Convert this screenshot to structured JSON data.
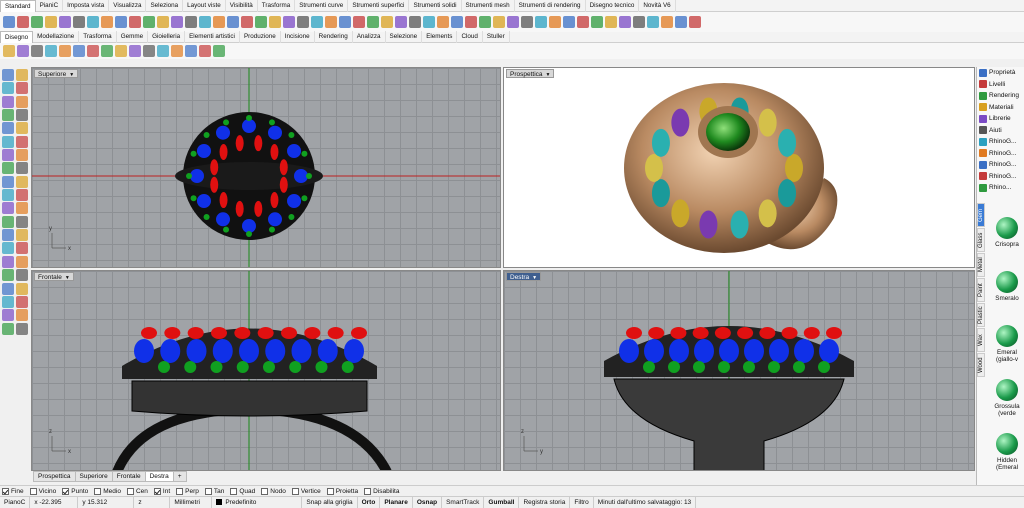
{
  "menu_tabs": [
    "Standard",
    "PianiC",
    "Imposta vista",
    "Visualizza",
    "Seleziona",
    "Layout viste",
    "Visibilità",
    "Trasforma",
    "Strumenti curve",
    "Strumenti superfici",
    "Strumenti solidi",
    "Strumenti mesh",
    "Strumenti di rendering",
    "Disegno tecnico",
    "Novità V6"
  ],
  "ribbon_tabs": [
    "Disegno",
    "Modellazione",
    "Trasforma",
    "Gemme",
    "Gioielleria",
    "Elementi artistici",
    "Produzione",
    "Incisione",
    "Rendering",
    "Analizza",
    "Selezione",
    "Elements",
    "Cloud",
    "Stuller"
  ],
  "viewports": {
    "top": "Superiore",
    "perspective": "Prospettica",
    "front": "Frontale",
    "right": "Destra"
  },
  "viewport_tabs": [
    "Prospettica",
    "Superiore",
    "Frontale",
    "Destra"
  ],
  "snaps": [
    {
      "label": "Fine",
      "on": true
    },
    {
      "label": "Vicino",
      "on": false
    },
    {
      "label": "Punto",
      "on": true
    },
    {
      "label": "Medio",
      "on": false
    },
    {
      "label": "Cen",
      "on": false
    },
    {
      "label": "Int",
      "on": true
    },
    {
      "label": "Perp",
      "on": false
    },
    {
      "label": "Tan",
      "on": false
    },
    {
      "label": "Quad",
      "on": false
    },
    {
      "label": "Nodo",
      "on": false
    },
    {
      "label": "Vertice",
      "on": false
    },
    {
      "label": "Proietta",
      "on": false
    },
    {
      "label": "Disabilita",
      "on": false
    }
  ],
  "status": {
    "plane": "PianoC",
    "x": "x -22.395",
    "y": "y 15.312",
    "z": "z",
    "units": "Millimetri",
    "layer": "Predefinito",
    "snap_grid": "Snap alla griglia",
    "ortho": "Orto",
    "planar": "Planare",
    "osnap": "Osnap",
    "smarttrack": "SmartTrack",
    "gumball": "Gumball",
    "history": "Registra storia",
    "filter": "Filtro",
    "autosave": "Minuti dall'ultimo salvataggio: 13"
  },
  "panel_items": [
    "Proprietà",
    "Livelli",
    "Rendering",
    "Materiali",
    "Librerie",
    "Aiuti",
    "RhinoG...",
    "RhinoG...",
    "RhinoG...",
    "RhinoG...",
    "Rhino..."
  ],
  "panel_tabs": [
    "Gem",
    "Glass",
    "Metal",
    "Paint",
    "Plastic",
    "Wax",
    "Wood"
  ],
  "materials": [
    "Crisopra",
    "Smeralo",
    "Emeral (giallo-v",
    "Grossula (verde",
    "Hidden (Emeral"
  ],
  "colors": {
    "blue_gem": "#1030e8",
    "red_gem": "#e01010",
    "green_gem": "#10a020",
    "grid": "#a0a3a7"
  }
}
